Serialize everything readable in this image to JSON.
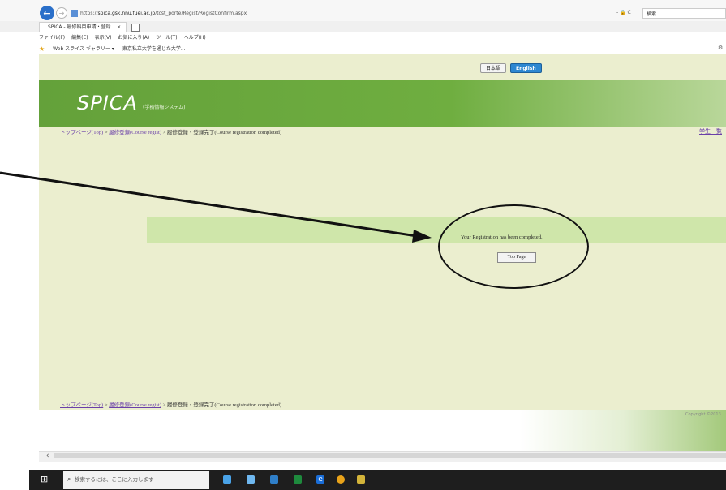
{
  "browser": {
    "back_label": "←",
    "forward_label": "→",
    "url_prefix": "https://",
    "url_host": "spica.gsk.nnu.fuei.ac.jp",
    "url_path": "/tcst_porte/Regist/RegistConfirm.aspx",
    "addr_icons": "- 🔒 C",
    "search_placeholder": "検索...",
    "tab_label": "SPICA - 履修科目申請・登録... ×",
    "menu": [
      "ファイル(F)",
      "編集(E)",
      "表示(V)",
      "お気に入り(A)",
      "ツール(T)",
      "ヘルプ(H)"
    ],
    "favorites": [
      "Web スライス ギャラリー ▾",
      "東京私立大学を通じた大学..."
    ]
  },
  "page": {
    "lang_ja": "日本語",
    "lang_en": "English",
    "logo": "SPICA",
    "logo_sub": "(学務情報システム)",
    "breadcrumb": {
      "top": "トップページ(Top)",
      "sep1": " > ",
      "course": "履修登録(Course regist)",
      "sep2": " > ",
      "current": "履修登録・登録完了(Course registration completed)"
    },
    "student_link": "学生一覧",
    "message": "Your Registration has been completed.",
    "top_page_button": "Top Page",
    "copyright": "Copyright ©2013"
  },
  "taskbar": {
    "start": "⊞",
    "search_placeholder": "検索するには、ここに入力します",
    "search_icon": "search-icon"
  },
  "colors": {
    "page_bg": "#ebeecf",
    "header_green": "#6fae40",
    "message_band": "#cfe6aa",
    "english_btn": "#2d87d1"
  }
}
